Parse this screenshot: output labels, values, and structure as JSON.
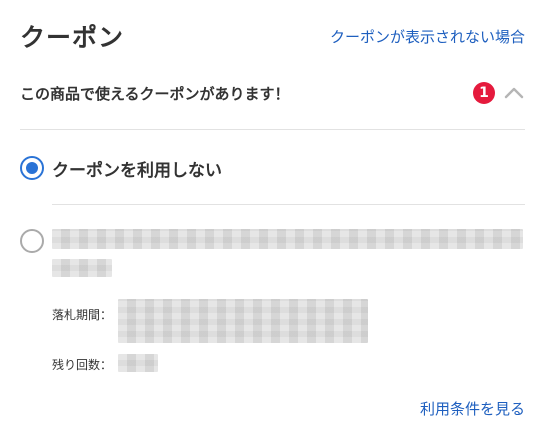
{
  "header": {
    "title": "クーポン",
    "help_link": "クーポンが表示されない場合"
  },
  "availability": {
    "text": "この商品で使えるクーポンがあります！",
    "count": "1",
    "toggle_icon": "chevron-up-icon"
  },
  "options": {
    "no_coupon_label": "クーポンを利用しない",
    "no_coupon_selected": true,
    "coupon": {
      "selected": false,
      "period_label": "落札期間：",
      "remaining_label": "残り回数："
    }
  },
  "footer": {
    "terms_link": "利用条件を見る"
  },
  "colors": {
    "accent": "#2a73d6",
    "link": "#1e5fbf",
    "badge": "#e51a3d"
  }
}
